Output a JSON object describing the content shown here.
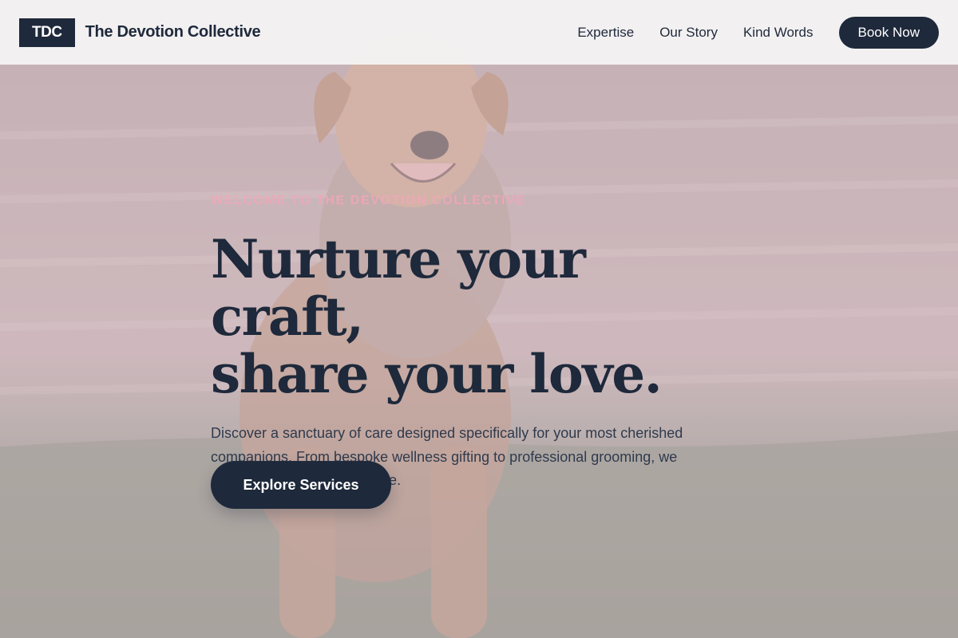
{
  "header": {
    "logo": "TDC",
    "brand_name": "The Devotion Collective",
    "nav": [
      {
        "label": "Expertise"
      },
      {
        "label": "Our Story"
      },
      {
        "label": "Kind Words"
      }
    ],
    "book_label": "Book Now"
  },
  "hero": {
    "eyebrow": "Welcome to The Devotion Collective",
    "headline_line1": "Nurture your craft,",
    "headline_line2": "share your love.",
    "description": "Discover a sanctuary of care designed specifically for your most cherished companions. From bespoke wellness gifting to professional grooming, we celebrate the bond you share.",
    "cta_label": "Explore Services",
    "background_image": "dog-sitting-on-grass-photo"
  },
  "colors": {
    "primary": "#1e293b",
    "accent_pink": "#f1a7b9",
    "header_bg": "#f4f3f4"
  }
}
